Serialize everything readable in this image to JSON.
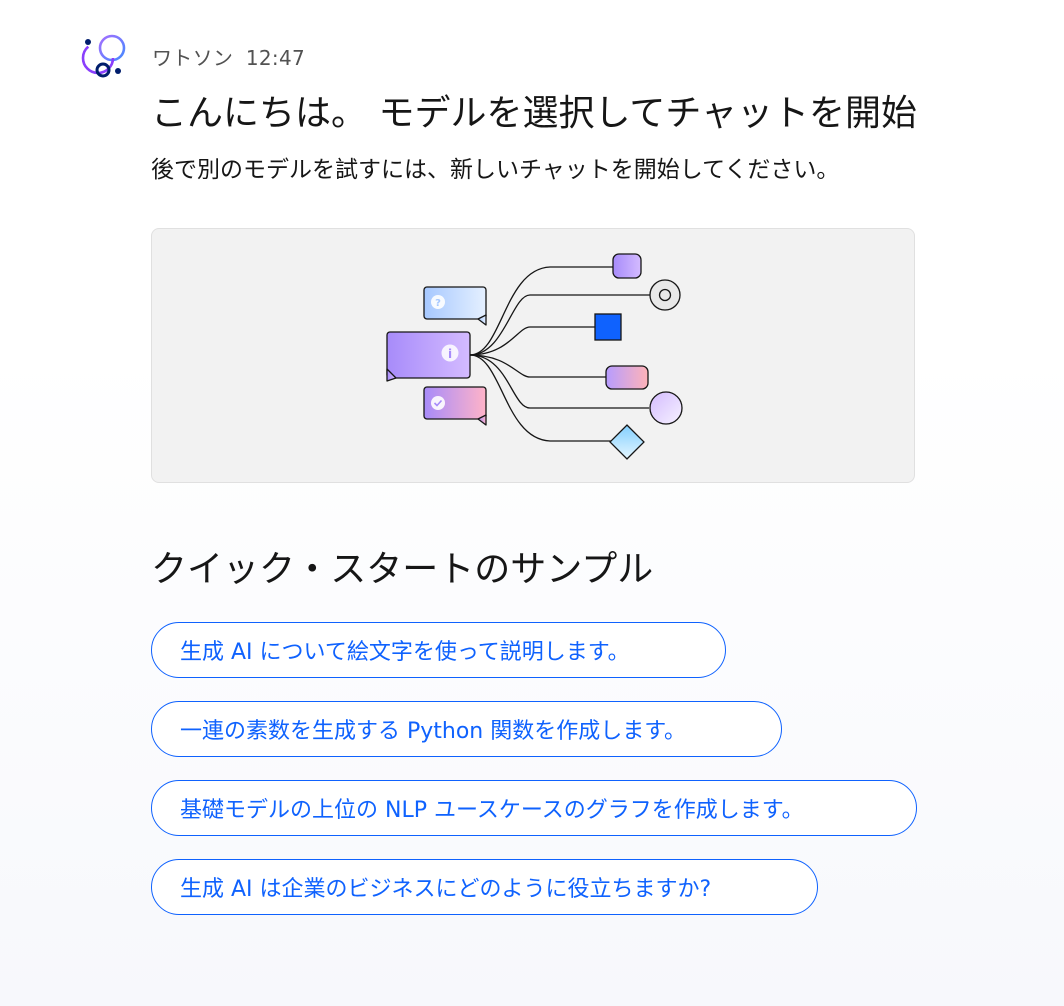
{
  "message": {
    "sender": "ワトソン",
    "time": "12:47",
    "greeting": "こんにちは。 モデルを選択してチャットを開始",
    "subtext": "後で別のモデルを試すには、新しいチャットを開始してください。"
  },
  "quick_start": {
    "heading": "クイック・スタートのサンプル",
    "samples": [
      "生成 AI について絵文字を使って説明します。",
      "一連の素数を生成する Python 関数を作成します。",
      "基礎モデルの上位の NLP ユースケースのグラフを作成します。",
      "生成 AI は企業のビジネスにどのように役立ちますか?"
    ]
  },
  "icons": {
    "avatar": "watson-assistant-icon",
    "illustration": "model-routing-illustration"
  },
  "colors": {
    "accent": "#0f62fe",
    "avatar_dark": "#001d6c",
    "avatar_light": "#8a3ffc"
  }
}
